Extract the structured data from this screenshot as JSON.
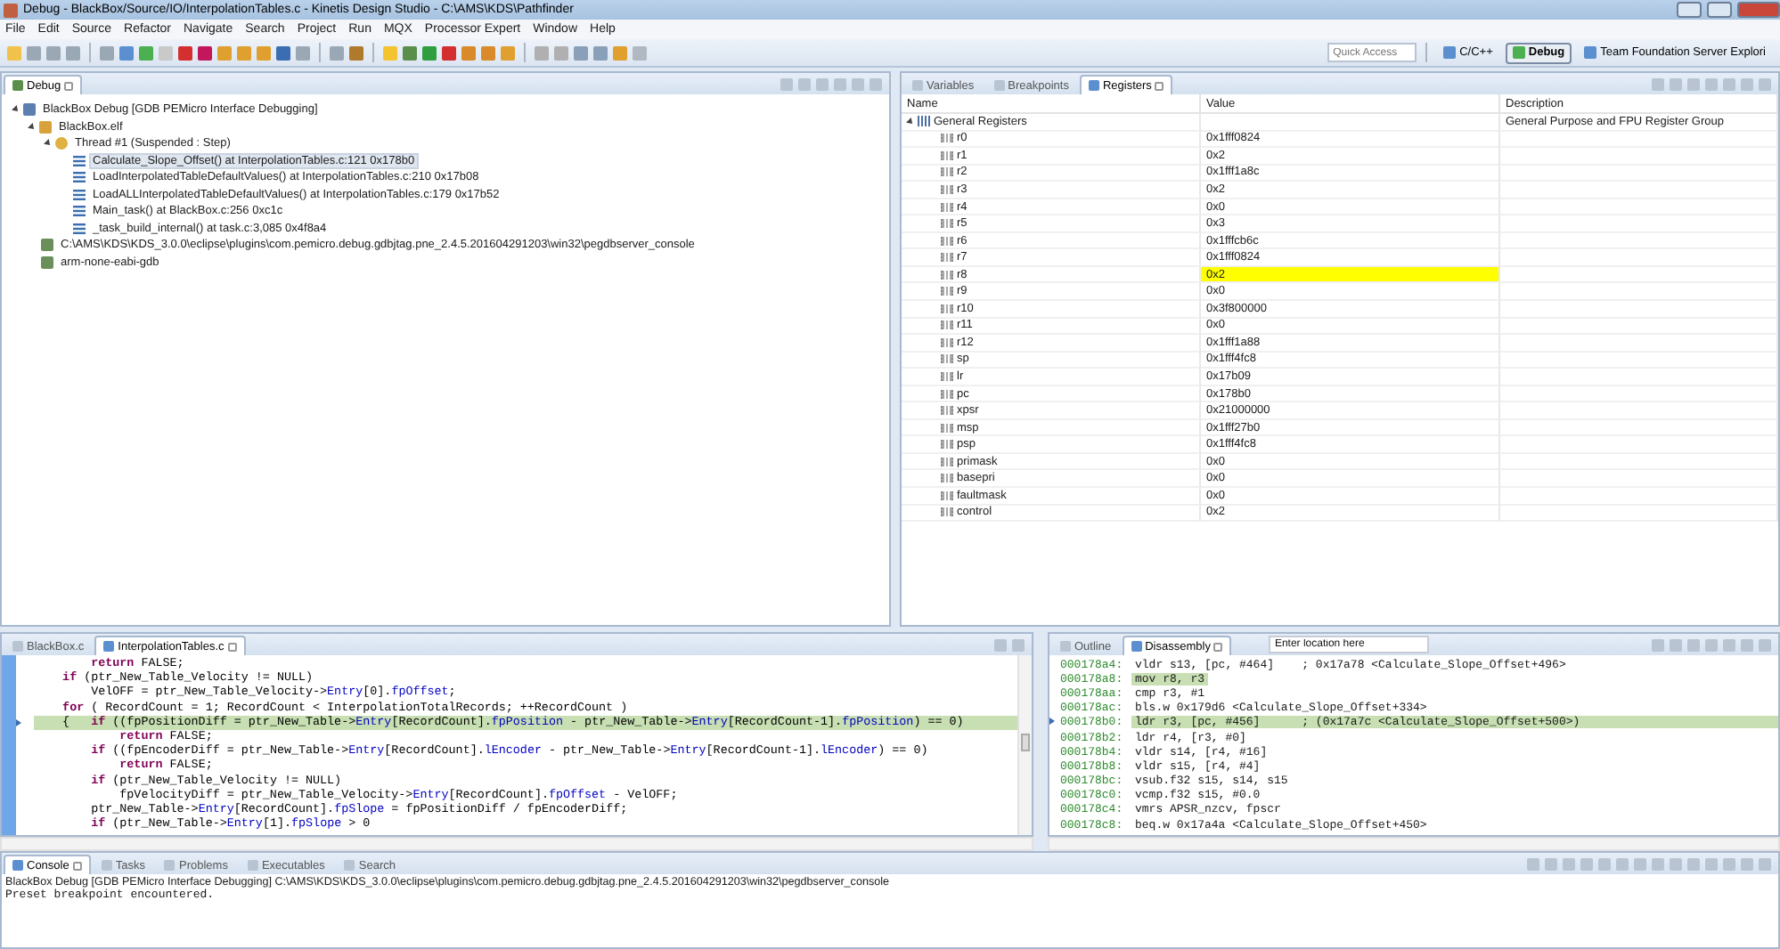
{
  "window": {
    "title": "Debug - BlackBox/Source/IO/InterpolationTables.c - Kinetis Design Studio - C:\\AMS\\KDS\\Pathfinder"
  },
  "menu": [
    "File",
    "Edit",
    "Source",
    "Refactor",
    "Navigate",
    "Search",
    "Project",
    "Run",
    "MQX",
    "Processor Expert",
    "Window",
    "Help"
  ],
  "toolbar": {
    "quick_access": {
      "placeholder": "Quick Access"
    },
    "perspectives": [
      {
        "label": "C/C++",
        "selected": false
      },
      {
        "label": "Debug",
        "selected": true
      },
      {
        "label": "Team Foundation Server Explori",
        "selected": false
      }
    ]
  },
  "debug_view": {
    "tab": "Debug",
    "tree": [
      {
        "label": "BlackBox Debug [GDB PEMicro Interface Debugging]",
        "kind": "launch",
        "expanded": true,
        "children": [
          {
            "label": "BlackBox.elf",
            "kind": "process",
            "expanded": true,
            "children": [
              {
                "label": "Thread #1 (Suspended : Step)",
                "kind": "thread",
                "expanded": true,
                "children": [
                  {
                    "label": "Calculate_Slope_Offset() at InterpolationTables.c:121 0x178b0",
                    "kind": "frame",
                    "selected": true
                  },
                  {
                    "label": "LoadInterpolatedTableDefaultValues() at InterpolationTables.c:210 0x17b08",
                    "kind": "frame",
                    "selected": false
                  },
                  {
                    "label": "LoadALLInterpolatedTableDefaultValues() at InterpolationTables.c:179 0x17b52",
                    "kind": "frame",
                    "selected": false
                  },
                  {
                    "label": "Main_task() at BlackBox.c:256 0xc1c",
                    "kind": "frame",
                    "selected": false
                  },
                  {
                    "label": "_task_build_internal() at task.c:3,085 0x4f8a4",
                    "kind": "frame",
                    "selected": false
                  }
                ]
              }
            ]
          },
          {
            "label": "C:\\AMS\\KDS\\KDS_3.0.0\\eclipse\\plugins\\com.pemicro.debug.gdbjtag.pne_2.4.5.201604291203\\win32\\pegdbserver_console",
            "kind": "console"
          },
          {
            "label": "arm-none-eabi-gdb",
            "kind": "console"
          }
        ]
      }
    ]
  },
  "registers_view": {
    "tabs": [
      {
        "label": "Variables",
        "selected": false
      },
      {
        "label": "Breakpoints",
        "selected": false
      },
      {
        "label": "Registers",
        "selected": true
      }
    ],
    "columns": [
      "Name",
      "Value",
      "Description"
    ],
    "group": {
      "name": "General Registers",
      "description": "General Purpose and FPU Register Group",
      "expanded": true,
      "registers": [
        {
          "name": "r0",
          "value": "0x1fff0824",
          "changed": false
        },
        {
          "name": "r1",
          "value": "0x2",
          "changed": false
        },
        {
          "name": "r2",
          "value": "0x1fff1a8c",
          "changed": false
        },
        {
          "name": "r3",
          "value": "0x2",
          "changed": false
        },
        {
          "name": "r4",
          "value": "0x0",
          "changed": false
        },
        {
          "name": "r5",
          "value": "0x3",
          "changed": false
        },
        {
          "name": "r6",
          "value": "0x1fffcb6c",
          "changed": false
        },
        {
          "name": "r7",
          "value": "0x1fff0824",
          "changed": false
        },
        {
          "name": "r8",
          "value": "0x2",
          "changed": true
        },
        {
          "name": "r9",
          "value": "0x0",
          "changed": false
        },
        {
          "name": "r10",
          "value": "0x3f800000",
          "changed": false
        },
        {
          "name": "r11",
          "value": "0x0",
          "changed": false
        },
        {
          "name": "r12",
          "value": "0x1fff1a88",
          "changed": false
        },
        {
          "name": "sp",
          "value": "0x1fff4fc8",
          "changed": false
        },
        {
          "name": "lr",
          "value": "0x17b09",
          "changed": false
        },
        {
          "name": "pc",
          "value": "0x178b0",
          "changed": false
        },
        {
          "name": "xpsr",
          "value": "0x21000000",
          "changed": false
        },
        {
          "name": "msp",
          "value": "0x1fff27b0",
          "changed": false
        },
        {
          "name": "psp",
          "value": "0x1fff4fc8",
          "changed": false
        },
        {
          "name": "primask",
          "value": "0x0",
          "changed": false
        },
        {
          "name": "basepri",
          "value": "0x0",
          "changed": false
        },
        {
          "name": "faultmask",
          "value": "0x0",
          "changed": false
        },
        {
          "name": "control",
          "value": "0x2",
          "changed": false
        }
      ]
    }
  },
  "editor": {
    "tabs": [
      {
        "label": "BlackBox.c",
        "selected": false
      },
      {
        "label": "InterpolationTables.c",
        "selected": true
      }
    ],
    "lines": [
      {
        "current": false,
        "tokens": [
          {
            "kind": "kw",
            "text": "        return"
          },
          {
            "kind": "plain",
            "text": " FALSE;"
          }
        ]
      },
      {
        "current": false,
        "tokens": [
          {
            "kind": "kw",
            "text": "    if"
          },
          {
            "kind": "plain",
            "text": " (ptr_New_Table_Velocity != NULL)"
          }
        ]
      },
      {
        "current": false,
        "tokens": [
          {
            "kind": "plain",
            "text": "        VelOFF = ptr_New_Table_Velocity->"
          },
          {
            "kind": "field",
            "text": "Entry"
          },
          {
            "kind": "plain",
            "text": "[0]."
          },
          {
            "kind": "field",
            "text": "fpOffset"
          },
          {
            "kind": "plain",
            "text": ";"
          }
        ]
      },
      {
        "current": false,
        "tokens": [
          {
            "kind": "kw",
            "text": "    for"
          },
          {
            "kind": "plain",
            "text": " ( RecordCount = 1; RecordCount < InterpolationTotalRecords; ++RecordCount )"
          }
        ]
      },
      {
        "current": true,
        "tokens": [
          {
            "kind": "plain",
            "text": "    {   "
          },
          {
            "kind": "kw",
            "text": "if"
          },
          {
            "kind": "plain",
            "text": " ((fpPositionDiff = ptr_New_Table->"
          },
          {
            "kind": "field",
            "text": "Entry"
          },
          {
            "kind": "plain",
            "text": "[RecordCount]."
          },
          {
            "kind": "field",
            "text": "fpPosition"
          },
          {
            "kind": "plain",
            "text": " - ptr_New_Table->"
          },
          {
            "kind": "field",
            "text": "Entry"
          },
          {
            "kind": "plain",
            "text": "[RecordCount-1]."
          },
          {
            "kind": "field",
            "text": "fpPosition"
          },
          {
            "kind": "plain",
            "text": ") == 0)"
          }
        ]
      },
      {
        "current": false,
        "tokens": [
          {
            "kind": "kw",
            "text": "            return"
          },
          {
            "kind": "plain",
            "text": " FALSE;"
          }
        ]
      },
      {
        "current": false,
        "tokens": [
          {
            "kind": "kw",
            "text": "        if"
          },
          {
            "kind": "plain",
            "text": " ((fpEncoderDiff = ptr_New_Table->"
          },
          {
            "kind": "field",
            "text": "Entry"
          },
          {
            "kind": "plain",
            "text": "[RecordCount]."
          },
          {
            "kind": "field",
            "text": "lEncoder"
          },
          {
            "kind": "plain",
            "text": " - ptr_New_Table->"
          },
          {
            "kind": "field",
            "text": "Entry"
          },
          {
            "kind": "plain",
            "text": "[RecordCount-1]."
          },
          {
            "kind": "field",
            "text": "lEncoder"
          },
          {
            "kind": "plain",
            "text": ") == 0)"
          }
        ]
      },
      {
        "current": false,
        "tokens": [
          {
            "kind": "kw",
            "text": "            return"
          },
          {
            "kind": "plain",
            "text": " FALSE;"
          }
        ]
      },
      {
        "current": false,
        "tokens": [
          {
            "kind": "kw",
            "text": "        if"
          },
          {
            "kind": "plain",
            "text": " (ptr_New_Table_Velocity != NULL)"
          }
        ]
      },
      {
        "current": false,
        "tokens": [
          {
            "kind": "plain",
            "text": "            fpVelocityDiff = ptr_New_Table_Velocity->"
          },
          {
            "kind": "field",
            "text": "Entry"
          },
          {
            "kind": "plain",
            "text": "[RecordCount]."
          },
          {
            "kind": "field",
            "text": "fpOffset"
          },
          {
            "kind": "plain",
            "text": " - VelOFF;"
          }
        ]
      },
      {
        "current": false,
        "tokens": [
          {
            "kind": "plain",
            "text": "        ptr_New_Table->"
          },
          {
            "kind": "field",
            "text": "Entry"
          },
          {
            "kind": "plain",
            "text": "[RecordCount]."
          },
          {
            "kind": "field",
            "text": "fpSlope"
          },
          {
            "kind": "plain",
            "text": " = fpPositionDiff / fpEncoderDiff;"
          }
        ]
      },
      {
        "current": false,
        "tokens": [
          {
            "kind": "kw",
            "text": "        if"
          },
          {
            "kind": "plain",
            "text": " (ptr_New_Table->"
          },
          {
            "kind": "field",
            "text": "Entry"
          },
          {
            "kind": "plain",
            "text": "[1]."
          },
          {
            "kind": "field",
            "text": "fpSlope"
          },
          {
            "kind": "plain",
            "text": " > 0"
          }
        ]
      }
    ]
  },
  "disassembly_view": {
    "tabs": [
      {
        "label": "Outline",
        "selected": false
      },
      {
        "label": "Disassembly",
        "selected": true
      }
    ],
    "location": {
      "placeholder": "Enter location here"
    },
    "rows": [
      {
        "address": "000178a4:",
        "instruction": "vldr s13, [pc, #464]    ; 0x17a78 <Calculate_Slope_Offset+496>",
        "highlighted": false,
        "current": false
      },
      {
        "address": "000178a8:",
        "instruction": "mov r8, r3",
        "highlighted": true,
        "current": false
      },
      {
        "address": "000178aa:",
        "instruction": "cmp r3, #1",
        "highlighted": false,
        "current": false
      },
      {
        "address": "000178ac:",
        "instruction": "bls.w 0x179d6 <Calculate_Slope_Offset+334>",
        "highlighted": false,
        "current": false
      },
      {
        "address": "000178b0:",
        "instruction": "ldr r3, [pc, #456]      ; (0x17a7c <Calculate_Slope_Offset+500>)",
        "highlighted": true,
        "current": true
      },
      {
        "address": "000178b2:",
        "instruction": "ldr r4, [r3, #0]",
        "highlighted": false,
        "current": false
      },
      {
        "address": "000178b4:",
        "instruction": "vldr s14, [r4, #16]",
        "highlighted": false,
        "current": false
      },
      {
        "address": "000178b8:",
        "instruction": "vldr s15, [r4, #4]",
        "highlighted": false,
        "current": false
      },
      {
        "address": "000178bc:",
        "instruction": "vsub.f32 s15, s14, s15",
        "highlighted": false,
        "current": false
      },
      {
        "address": "000178c0:",
        "instruction": "vcmp.f32 s15, #0.0",
        "highlighted": false,
        "current": false
      },
      {
        "address": "000178c4:",
        "instruction": "vmrs APSR_nzcv, fpscr",
        "highlighted": false,
        "current": false
      },
      {
        "address": "000178c8:",
        "instruction": "beq.w 0x17a4a <Calculate_Slope_Offset+450>",
        "highlighted": false,
        "current": false
      }
    ]
  },
  "console_view": {
    "tabs": [
      {
        "label": "Console",
        "selected": true
      },
      {
        "label": "Tasks",
        "selected": false
      },
      {
        "label": "Problems",
        "selected": false
      },
      {
        "label": "Executables",
        "selected": false
      },
      {
        "label": "Search",
        "selected": false
      }
    ],
    "header": "BlackBox Debug [GDB PEMicro Interface Debugging] C:\\AMS\\KDS\\KDS_3.0.0\\eclipse\\plugins\\com.pemicro.debug.gdbjtag.pne_2.4.5.201604291203\\win32\\pegdbserver_console",
    "output": [
      "Preset breakpoint encountered."
    ]
  }
}
